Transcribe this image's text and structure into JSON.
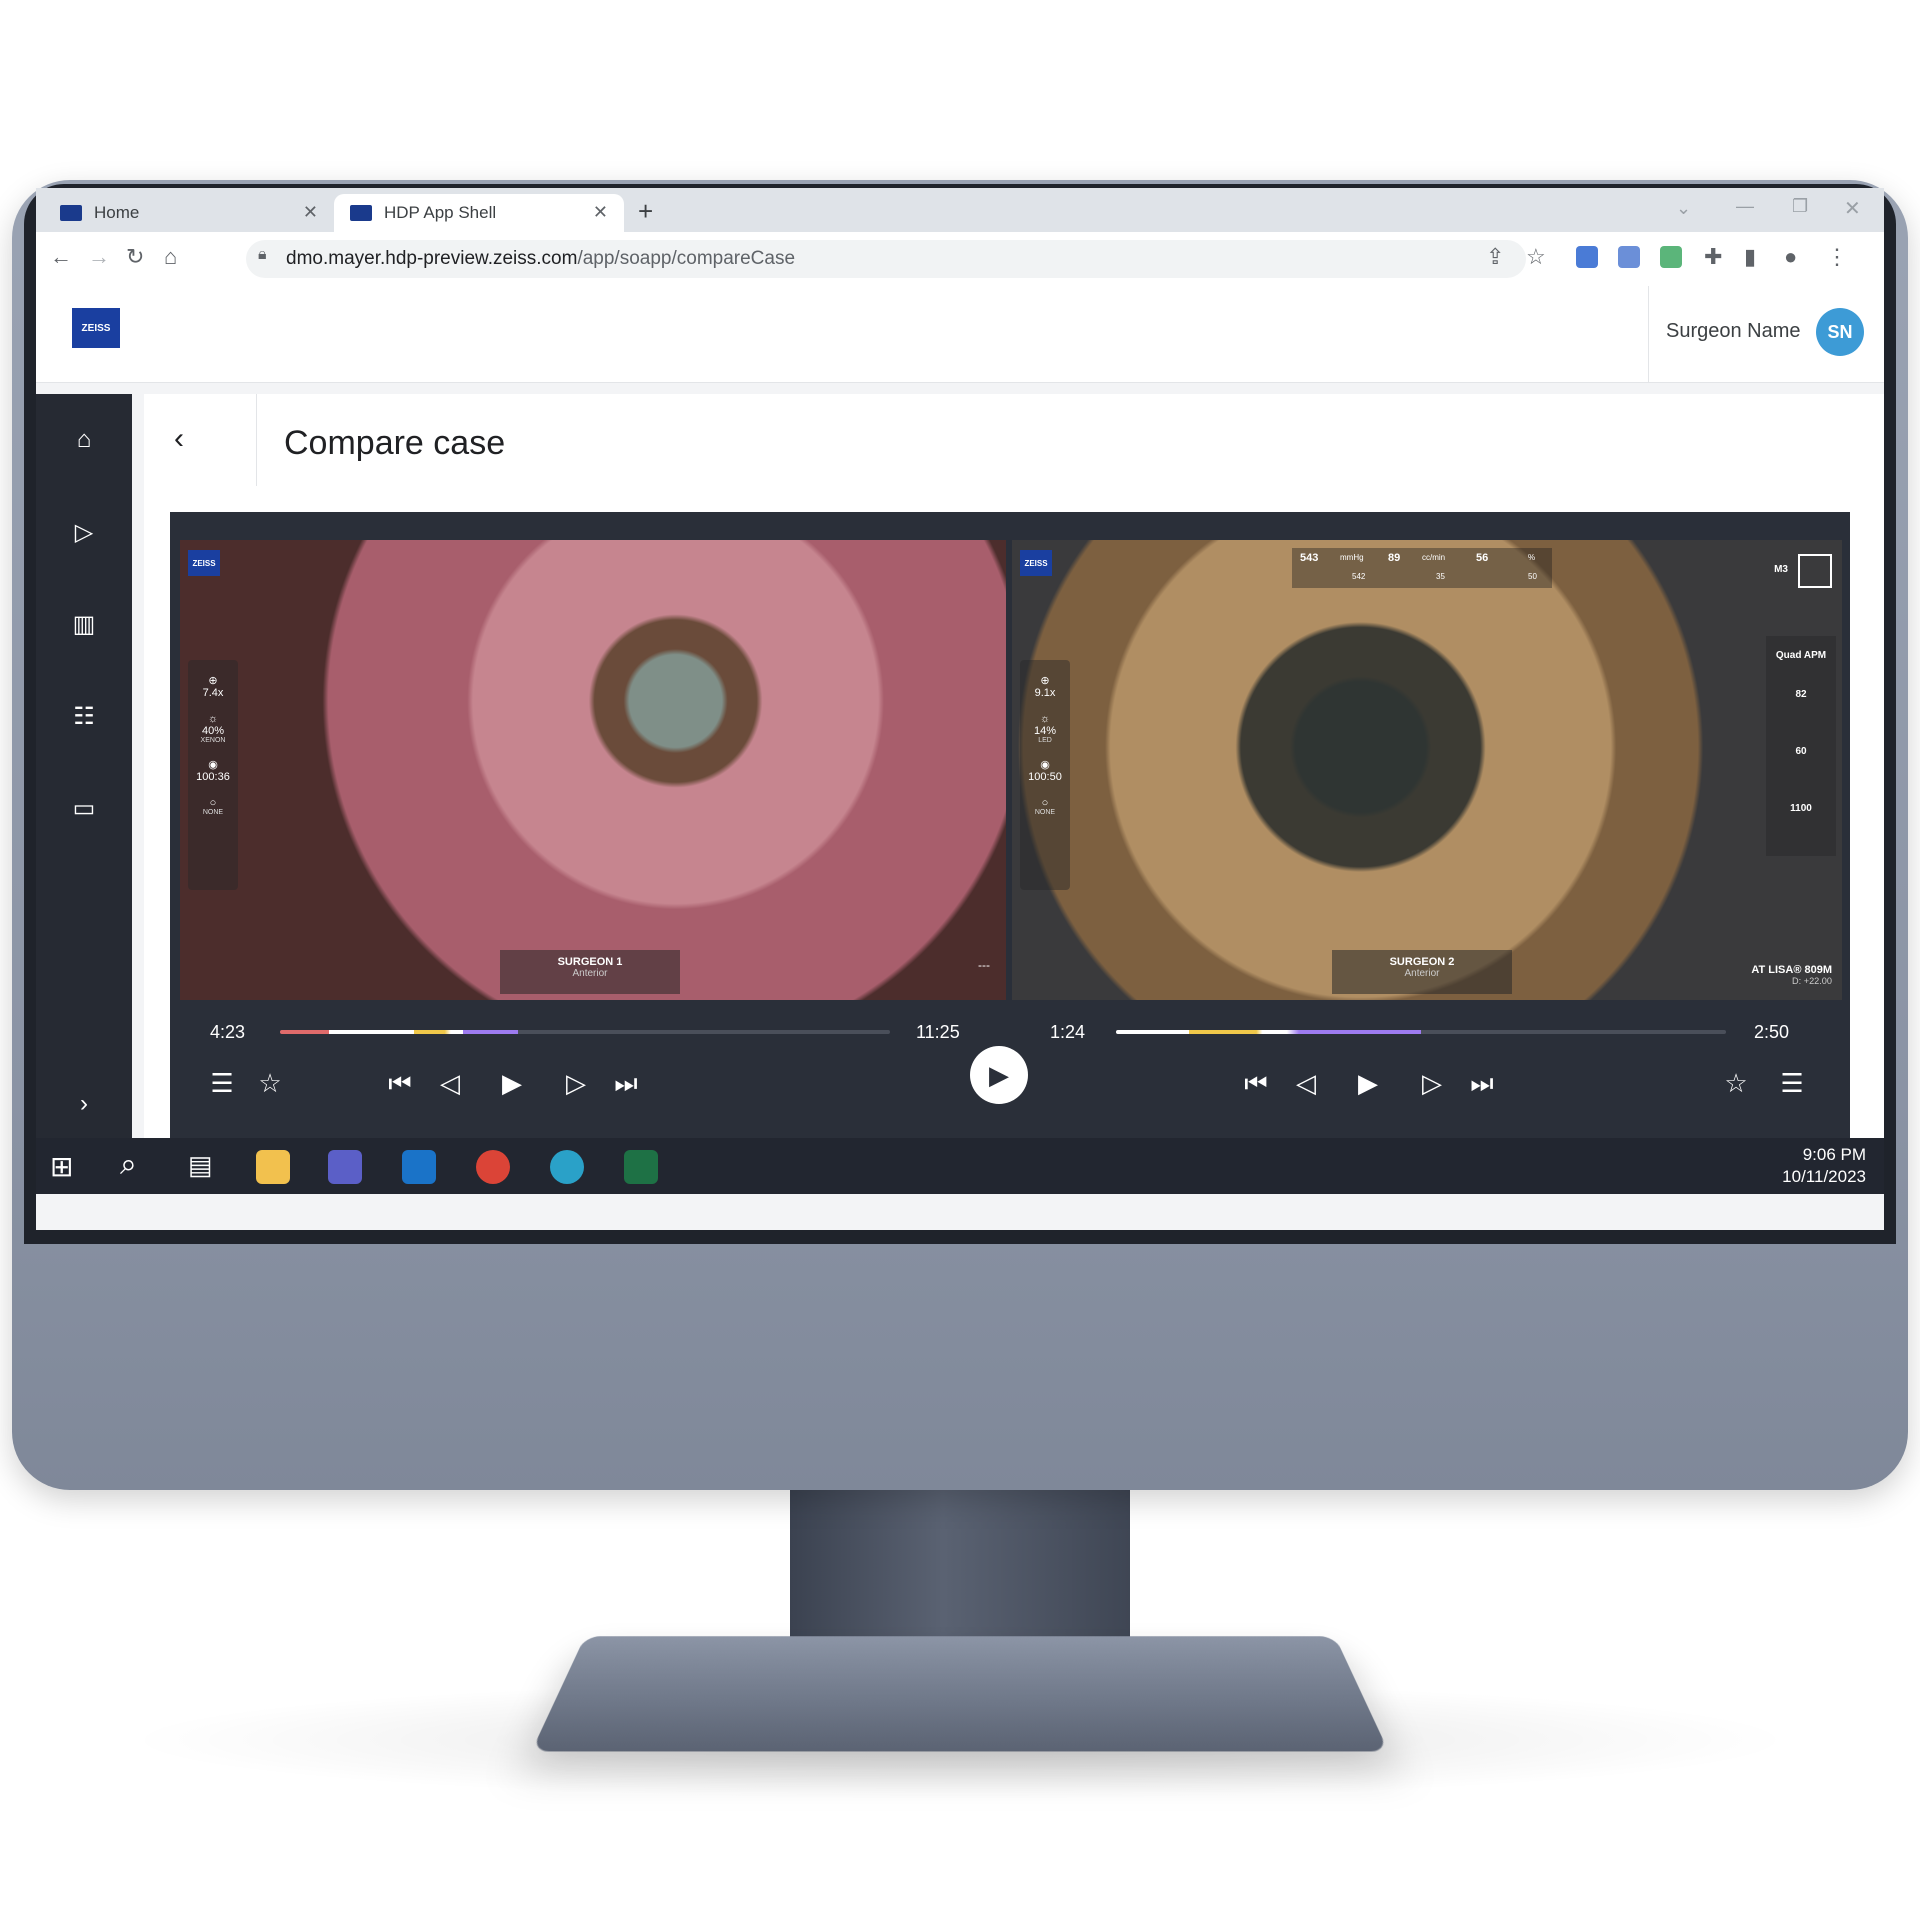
{
  "browser": {
    "tabs": [
      {
        "label": "Home"
      },
      {
        "label": "HDP App Shell"
      }
    ],
    "url_host": "dmo.mayer.hdp-preview.zeiss.com",
    "url_path": "/app/soapp/compareCase"
  },
  "app": {
    "logo_text": "ZEISS",
    "user_name": "Surgeon Name",
    "user_initials": "SN"
  },
  "sidebar": {
    "items": [
      {
        "icon": "home-icon"
      },
      {
        "icon": "play-icon"
      },
      {
        "icon": "bar-chart-icon"
      },
      {
        "icon": "user-list-icon"
      },
      {
        "icon": "comment-icon"
      }
    ],
    "expand_icon": "chevron-right-icon"
  },
  "page": {
    "title": "Compare case"
  },
  "left_video": {
    "logo_text": "ZEISS",
    "zoom": "7.4x",
    "light": "40%",
    "light_type": "XENON",
    "focus": "100:36",
    "filter": "NONE",
    "surgeon": "SURGEON 1",
    "view": "Anterior",
    "right_caption": "---",
    "current_time": "4:23",
    "total_time": "11:25"
  },
  "right_video": {
    "logo_text": "ZEISS",
    "zoom": "9.1x",
    "light": "14%",
    "light_type": "LED",
    "focus": "100:50",
    "filter": "NONE",
    "stats": [
      {
        "value": "543",
        "unit": "mmHg",
        "sub": "542"
      },
      {
        "value": "89",
        "unit": "cc/min",
        "sub": "35"
      },
      {
        "value": "56",
        "unit": "%",
        "sub": "50"
      }
    ],
    "mode_badge": "M3",
    "device_label": "Quad APM",
    "device_values": [
      "82",
      "60",
      "1100"
    ],
    "surgeon": "SURGEON 2",
    "view": "Anterior",
    "lens": "AT LISA® 809M",
    "diopter": "D: +22.00",
    "current_time": "1:24",
    "total_time": "2:50"
  },
  "taskbar": {
    "time": "9:06 PM",
    "date": "10/11/2023"
  }
}
